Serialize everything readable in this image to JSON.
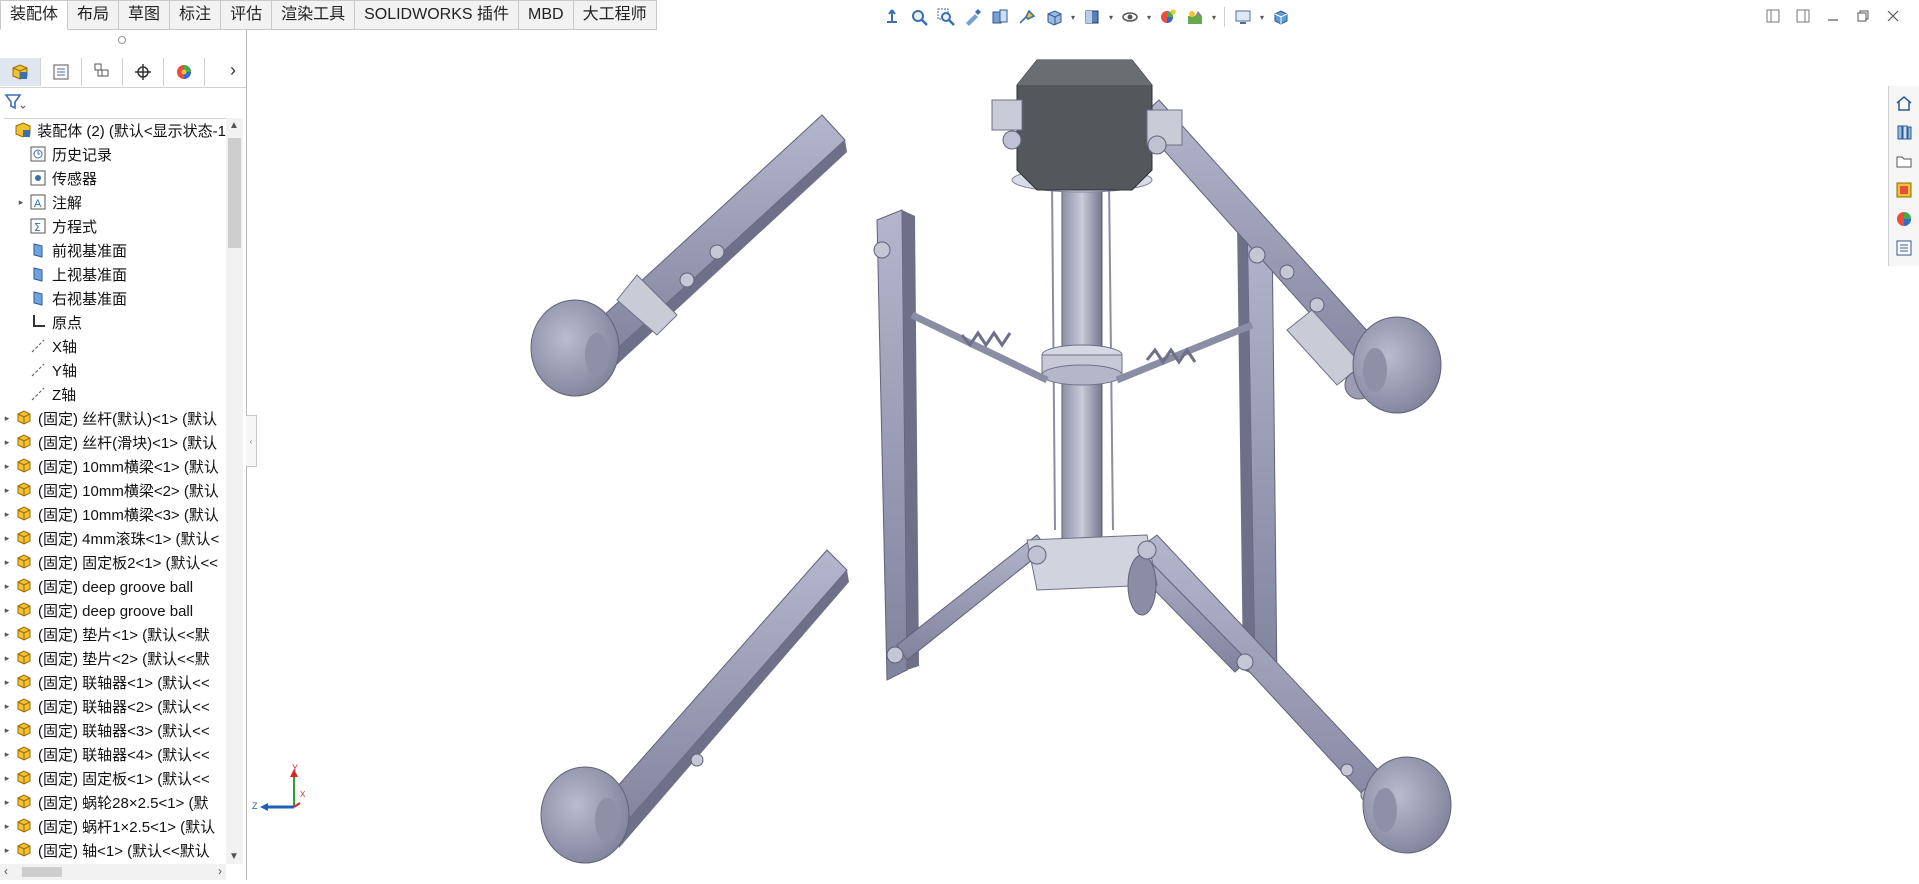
{
  "tabs": [
    {
      "label": "装配体",
      "active": true
    },
    {
      "label": "布局"
    },
    {
      "label": "草图"
    },
    {
      "label": "标注"
    },
    {
      "label": "评估"
    },
    {
      "label": "渲染工具"
    },
    {
      "label": "SOLIDWORKS 插件"
    },
    {
      "label": "MBD"
    },
    {
      "label": "大工程师"
    }
  ],
  "heads_up_icons": [
    "pointer-icon",
    "zoom-to-fit-icon",
    "zoom-to-area-icon",
    "previous-view-icon",
    "section-view-icon",
    "dynamic-annotation-icon",
    "view-orientation-icon",
    "display-style-icon",
    "hide-show-icon",
    "edit-appearance-icon",
    "apply-scene-icon",
    "view-settings-icon",
    "display-pane-icon"
  ],
  "window_controls": [
    "tile-left-icon",
    "tile-right-icon",
    "minimize-icon",
    "restore-icon",
    "close-icon"
  ],
  "panel": {
    "tabs": [
      "feature-manager-icon",
      "property-manager-icon",
      "configuration-manager-icon",
      "dimxpert-icon",
      "display-manager-icon"
    ],
    "filter_icon": "filter-icon",
    "tree": [
      {
        "label": "装配体 (2)  (默认<显示状态-1",
        "icon": "assembly-icon",
        "expand": false,
        "indent": 0,
        "top": true
      },
      {
        "label": "历史记录",
        "icon": "history-icon",
        "indent": 1
      },
      {
        "label": "传感器",
        "icon": "sensor-icon",
        "indent": 1
      },
      {
        "label": "注解",
        "icon": "annotation-icon",
        "indent": 1,
        "expand": true
      },
      {
        "label": "方程式",
        "icon": "equation-icon",
        "indent": 1
      },
      {
        "label": "前视基准面",
        "icon": "plane-icon",
        "indent": 1
      },
      {
        "label": "上视基准面",
        "icon": "plane-icon",
        "indent": 1
      },
      {
        "label": "右视基准面",
        "icon": "plane-icon",
        "indent": 1
      },
      {
        "label": "原点",
        "icon": "origin-icon",
        "indent": 1
      },
      {
        "label": "X轴",
        "icon": "axis-icon",
        "indent": 1
      },
      {
        "label": "Y轴",
        "icon": "axis-icon",
        "indent": 1
      },
      {
        "label": "Z轴",
        "icon": "axis-icon",
        "indent": 1
      },
      {
        "label": "(固定) 丝杆(默认)<1> (默认",
        "icon": "part-icon",
        "indent": 0,
        "expand": true
      },
      {
        "label": "(固定) 丝杆(滑块)<1> (默认",
        "icon": "part-icon",
        "indent": 0,
        "expand": true
      },
      {
        "label": "(固定) 10mm横梁<1> (默认",
        "icon": "part-icon",
        "indent": 0,
        "expand": true
      },
      {
        "label": "(固定) 10mm横梁<2> (默认",
        "icon": "part-icon",
        "indent": 0,
        "expand": true
      },
      {
        "label": "(固定) 10mm横梁<3> (默认",
        "icon": "part-icon",
        "indent": 0,
        "expand": true
      },
      {
        "label": "(固定) 4mm滚珠<1> (默认<",
        "icon": "part-icon",
        "indent": 0,
        "expand": true
      },
      {
        "label": "(固定) 固定板2<1> (默认<<",
        "icon": "part-icon",
        "indent": 0,
        "expand": true
      },
      {
        "label": "(固定) deep groove ball",
        "icon": "part-icon",
        "indent": 0,
        "expand": true
      },
      {
        "label": "(固定) deep groove ball",
        "icon": "part-icon",
        "indent": 0,
        "expand": true
      },
      {
        "label": "(固定) 垫片<1> (默认<<默",
        "icon": "part-icon",
        "indent": 0,
        "expand": true
      },
      {
        "label": "(固定) 垫片<2> (默认<<默",
        "icon": "part-icon",
        "indent": 0,
        "expand": true
      },
      {
        "label": "(固定) 联轴器<1> (默认<<",
        "icon": "part-icon",
        "indent": 0,
        "expand": true
      },
      {
        "label": "(固定) 联轴器<2> (默认<<",
        "icon": "part-icon",
        "indent": 0,
        "expand": true
      },
      {
        "label": "(固定) 联轴器<3> (默认<<",
        "icon": "part-icon",
        "indent": 0,
        "expand": true
      },
      {
        "label": "(固定) 联轴器<4> (默认<<",
        "icon": "part-icon",
        "indent": 0,
        "expand": true
      },
      {
        "label": "(固定) 固定板<1> (默认<<",
        "icon": "part-icon",
        "indent": 0,
        "expand": true
      },
      {
        "label": "(固定) 蜗轮28×2.5<1> (默",
        "icon": "part-icon",
        "indent": 0,
        "expand": true
      },
      {
        "label": "(固定) 蜗杆1×2.5<1> (默认",
        "icon": "part-icon",
        "indent": 0,
        "expand": true
      },
      {
        "label": "(固定) 轴<1> (默认<<默认",
        "icon": "part-icon",
        "indent": 0,
        "expand": true
      }
    ]
  },
  "triad": {
    "y": "Y",
    "z": "Z",
    "x": "X"
  },
  "task_pane": [
    "home-icon",
    "design-library-icon",
    "file-explorer-icon",
    "view-palette-icon",
    "appearances-icon",
    "custom-properties-icon"
  ],
  "colors": {
    "part": "#8c8fa8",
    "part_dark": "#5f6278",
    "housing": "#4e5155",
    "accent_blue": "#1f5fb5"
  }
}
